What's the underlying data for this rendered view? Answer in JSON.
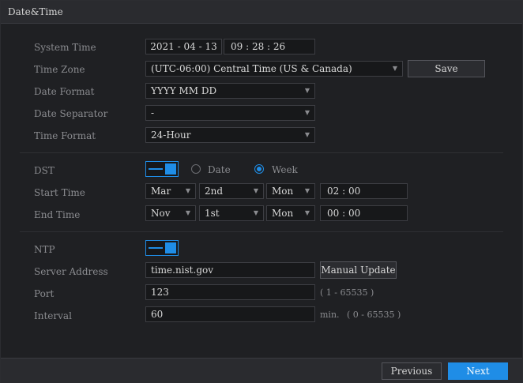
{
  "window": {
    "title": "Date&Time"
  },
  "fields": {
    "system_time": {
      "label": "System Time",
      "date": "2021 - 04 - 13",
      "time": "09 : 28 : 26"
    },
    "time_zone": {
      "label": "Time Zone",
      "value": "(UTC-06:00) Central Time (US & Canada)"
    },
    "date_format": {
      "label": "Date Format",
      "value": "YYYY MM DD"
    },
    "date_separator": {
      "label": "Date Separator",
      "value": "-"
    },
    "time_format": {
      "label": "Time Format",
      "value": "24-Hour"
    }
  },
  "buttons": {
    "save": "Save",
    "manual_update": "Manual Update",
    "previous": "Previous",
    "next": "Next"
  },
  "dst": {
    "label": "DST",
    "enabled": true,
    "mode_options": [
      "Date",
      "Week"
    ],
    "selected_mode": "Week",
    "start_label": "Start Time",
    "start": {
      "month": "Mar",
      "week": "2nd",
      "day": "Mon",
      "time": "02 : 00"
    },
    "end_label": "End Time",
    "end": {
      "month": "Nov",
      "week": "1st",
      "day": "Mon",
      "time": "00 : 00"
    }
  },
  "ntp": {
    "label": "NTP",
    "enabled": true,
    "server_label": "Server Address",
    "server": "time.nist.gov",
    "port_label": "Port",
    "port": "123",
    "port_hint": "( 1 - 65535 )",
    "interval_label": "Interval",
    "interval": "60",
    "interval_unit": "min.",
    "interval_hint": "( 0 - 65535 )"
  },
  "colors": {
    "accent": "#1f8de6",
    "background": "#1f2023",
    "label": "#8a8b8f"
  },
  "icons": {
    "dropdown": "chevron-down-icon",
    "toggle": "toggle-switch-icon"
  }
}
